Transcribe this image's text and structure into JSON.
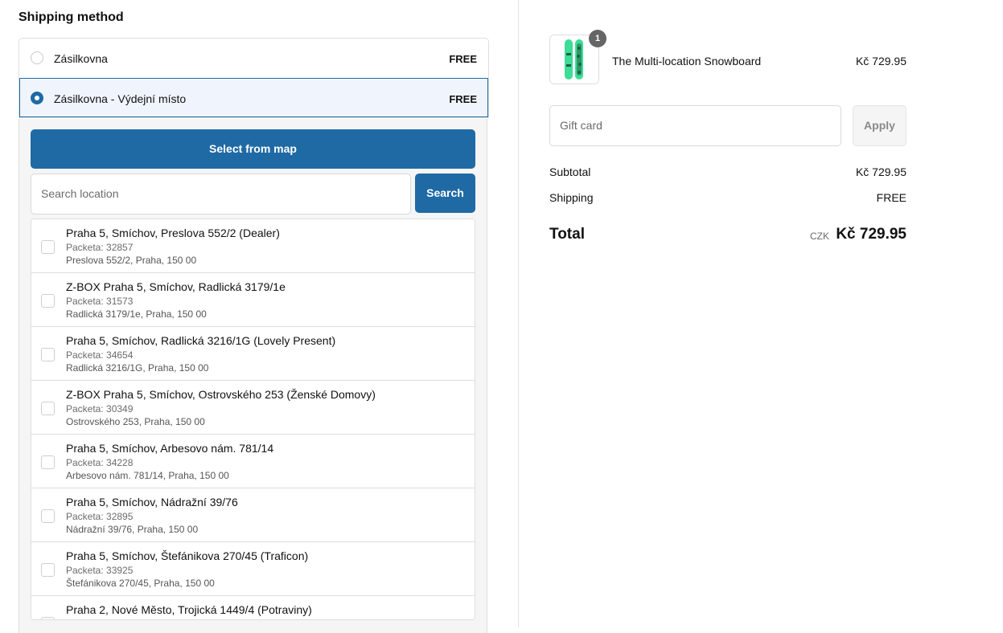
{
  "shipping": {
    "title": "Shipping method",
    "methods": [
      {
        "label": "Zásilkovna",
        "price": "FREE",
        "selected": false
      },
      {
        "label": "Zásilkovna - Výdejní místo",
        "price": "FREE",
        "selected": true
      }
    ],
    "select_from_map_label": "Select from map",
    "search_placeholder": "Search location",
    "search_button_label": "Search",
    "locations": [
      {
        "name": "Praha 5, Smíchov, Preslova 552/2 (Dealer)",
        "code": "Packeta: 32857",
        "address": "Preslova 552/2, Praha, 150 00"
      },
      {
        "name": "Z-BOX Praha 5, Smíchov, Radlická 3179/1e",
        "code": "Packeta: 31573",
        "address": "Radlická 3179/1e, Praha, 150 00"
      },
      {
        "name": "Praha 5, Smíchov, Radlická 3216/1G (Lovely Present)",
        "code": "Packeta: 34654",
        "address": "Radlická 3216/1G, Praha, 150 00"
      },
      {
        "name": "Z-BOX Praha 5, Smíchov, Ostrovského 253 (Ženské Domovy)",
        "code": "Packeta: 30349",
        "address": "Ostrovského 253, Praha, 150 00"
      },
      {
        "name": "Praha 5, Smíchov, Arbesovo nám. 781/14",
        "code": "Packeta: 34228",
        "address": "Arbesovo nám. 781/14, Praha, 150 00"
      },
      {
        "name": "Praha 5, Smíchov, Nádražní 39/76",
        "code": "Packeta: 32895",
        "address": "Nádražní 39/76, Praha, 150 00"
      },
      {
        "name": "Praha 5, Smíchov, Štefánikova 270/45 (Traficon)",
        "code": "Packeta: 33925",
        "address": "Štefánikova 270/45, Praha, 150 00"
      },
      {
        "name": "Praha 2, Nové Město, Trojická 1449/4 (Potraviny)",
        "code": "",
        "address": ""
      }
    ]
  },
  "summary": {
    "product": {
      "name": "The Multi-location Snowboard",
      "price": "Kč 729.95",
      "quantity": "1"
    },
    "gift_card_placeholder": "Gift card",
    "apply_label": "Apply",
    "subtotal_label": "Subtotal",
    "subtotal_value": "Kč 729.95",
    "shipping_label": "Shipping",
    "shipping_value": "FREE",
    "total_label": "Total",
    "total_currency": "CZK",
    "total_value": "Kč 729.95"
  },
  "colors": {
    "accent": "#1f6aa5",
    "snowboard": "#3ddc97"
  }
}
